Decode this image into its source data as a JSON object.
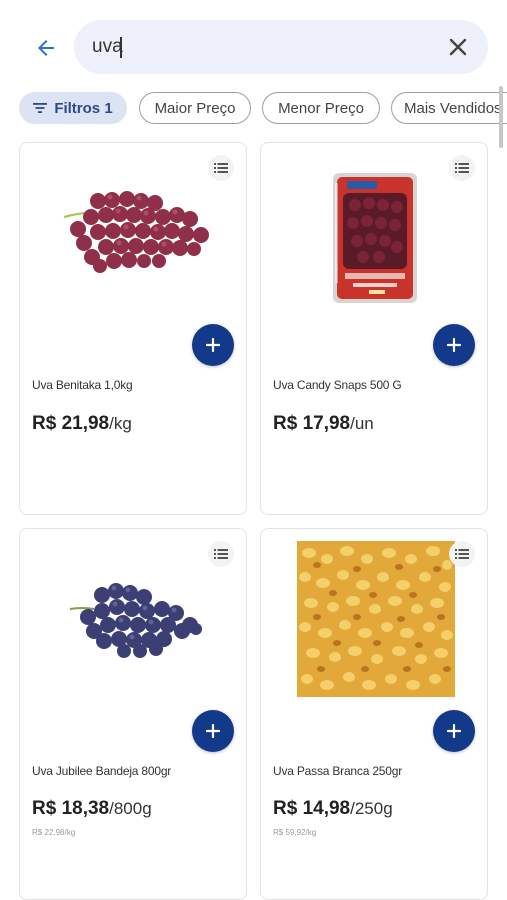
{
  "search": {
    "value": "uva",
    "placeholder": ""
  },
  "chips": [
    {
      "label": "Filtros",
      "count": "1",
      "active": true
    },
    {
      "label": "Maior Preço"
    },
    {
      "label": "Menor Preço"
    },
    {
      "label": "Mais Vendidos"
    }
  ],
  "products": [
    {
      "name": "Uva Benitaka 1,0kg",
      "price": "R$ 21,98",
      "unit": "/kg",
      "unit_price": ""
    },
    {
      "name": "Uva Candy Snaps 500 G",
      "price": "R$ 17,98",
      "unit": "/un",
      "unit_price": ""
    },
    {
      "name": "Uva Jubilee Bandeja 800gr",
      "price": "R$ 18,38",
      "unit": "/800g",
      "unit_price": "R$ 22,98/kg"
    },
    {
      "name": "Uva Passa Branca 250gr",
      "price": "R$ 14,98",
      "unit": "/250g",
      "unit_price": "R$ 59,92/kg"
    }
  ],
  "colors": {
    "accent": "#12398a",
    "search_bg": "#eef1fb",
    "chip_active_bg": "#dce3f3",
    "back_arrow": "#2f6fd6"
  },
  "icons": {
    "back": "arrow-left-icon",
    "clear": "close-icon",
    "filter": "filter-lines-icon",
    "list": "list-icon",
    "add": "plus-icon"
  }
}
